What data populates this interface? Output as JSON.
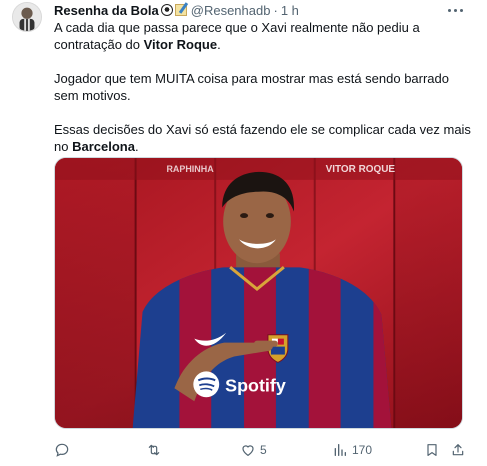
{
  "tweet": {
    "author_name": "Resenha da Bola",
    "author_handle": "@Resenhadb",
    "separator": "·",
    "time": "1 h",
    "paragraph1_pre": "A cada dia que passa parece que o Xavi realmente não pediu a contratação do ",
    "paragraph1_bold": "Vitor Roque",
    "paragraph1_post": ".",
    "paragraph2": "Jogador que tem MUITA coisa para mostrar mas está sendo barrado sem motivos.",
    "paragraph3_pre": "Essas decisões do Xavi só está fazendo ele se complicar cada vez mais no ",
    "paragraph3_bold": "Barcelona",
    "paragraph3_post": ".",
    "image": {
      "banner_left": "RAPHINHA",
      "banner_right": "VITOR ROQUE",
      "sponsor": "Spotify"
    }
  },
  "actions": {
    "reply_count": "",
    "retweet_count": "",
    "like_count": "5",
    "views_count": "170"
  },
  "icons": {
    "reply": "reply-icon",
    "retweet": "retweet-icon",
    "like": "heart-icon",
    "views": "views-icon",
    "bookmark": "bookmark-icon",
    "share": "share-icon",
    "more": "more-icon"
  },
  "colors": {
    "text_primary": "#0f1419",
    "text_secondary": "#536471",
    "photo_red": "#b41e2a",
    "kit_blue": "#1d3f8f",
    "kit_garnet": "#a3123a"
  }
}
